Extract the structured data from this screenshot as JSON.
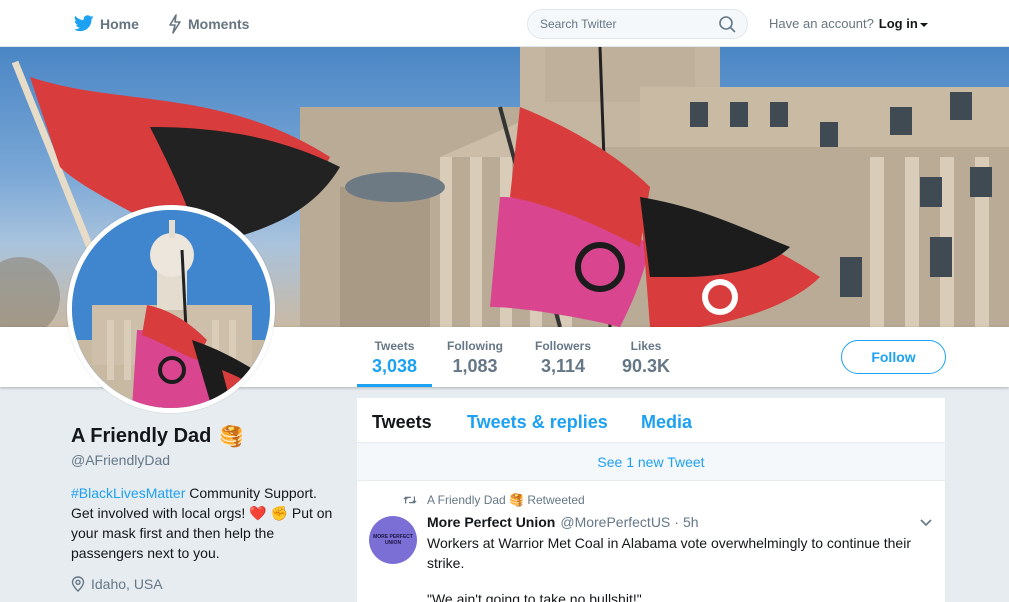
{
  "nav": {
    "home_label": "Home",
    "moments_label": "Moments",
    "search_placeholder": "Search Twitter",
    "account_prompt": "Have an account?",
    "login_label": "Log in"
  },
  "profile": {
    "display_name": "A Friendly Dad",
    "name_emoji": "🥞",
    "handle": "@AFriendlyDad",
    "bio_hashtag": "#BlackLivesMatter",
    "bio_text_1": " Community Support. Get involved with local orgs! ",
    "bio_emoji": "❤️ ✊",
    "bio_text_2": " Put on your mask first and then help the passengers next to you.",
    "location": "Idaho, USA"
  },
  "stats": [
    {
      "label": "Tweets",
      "value": "3,038",
      "active": true
    },
    {
      "label": "Following",
      "value": "1,083"
    },
    {
      "label": "Followers",
      "value": "3,114"
    },
    {
      "label": "Likes",
      "value": "90.3K"
    }
  ],
  "follow_label": "Follow",
  "timeline": {
    "tabs": [
      {
        "label": "Tweets",
        "active": true
      },
      {
        "label": "Tweets & replies"
      },
      {
        "label": "Media"
      }
    ],
    "new_tweet_label": "See 1 new Tweet",
    "tweet": {
      "retweet_by": "A Friendly Dad",
      "retweet_emoji": "🥞",
      "retweet_suffix": "Retweeted",
      "author_name": "More Perfect Union",
      "author_handle": "@MorePerfectUS",
      "separator": "·",
      "timestamp": "5h",
      "avatar_text": "MORE PERFECT UNION",
      "text": "Workers at Warrior Met Coal in Alabama vote overwhelmingly to continue their strike.",
      "quote": "\"We ain't going to take no bullshit!\""
    }
  },
  "colors": {
    "accent": "#1da1f2",
    "text": "#14171a",
    "secondary": "#657786",
    "background": "#e6ecf0"
  }
}
